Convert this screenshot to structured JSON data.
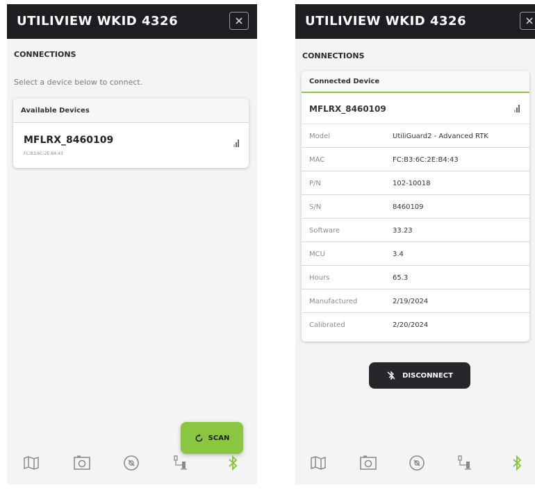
{
  "screens": [
    {
      "title": "UTILIVIEW WKID 4326",
      "section": "CONNECTIONS",
      "hint": "Select a device below to connect.",
      "card_title": "Available Devices",
      "device": {
        "name": "MFLRX_8460109",
        "mac": "FC:B3:6C:2E:B4:43"
      },
      "scan_label": "SCAN"
    },
    {
      "title": "UTILIVIEW WKID 4326",
      "section": "CONNECTIONS",
      "card_title": "Connected Device",
      "device_name": "MFLRX_8460109",
      "details": [
        {
          "label": "Model",
          "value": "UtiliGuard2 - Advanced RTK"
        },
        {
          "label": "MAC",
          "value": "FC:B3:6C:2E:B4:43"
        },
        {
          "label": "P/N",
          "value": "102-10018"
        },
        {
          "label": "S/N",
          "value": "8460109"
        },
        {
          "label": "Software",
          "value": "33.23"
        },
        {
          "label": "MCU",
          "value": "3.4"
        },
        {
          "label": "Hours",
          "value": "65.3"
        },
        {
          "label": "Manufactured",
          "value": "2/19/2024"
        },
        {
          "label": "Calibrated",
          "value": "2/20/2024"
        }
      ],
      "disconnect_label": "DISCONNECT"
    }
  ],
  "colors": {
    "header": "#1d1e22",
    "accent": "#8bc640",
    "background": "#f4f4f4"
  },
  "nav_icons": [
    "map-icon",
    "camera-icon",
    "compass-icon",
    "gps-receiver-icon",
    "bluetooth-icon"
  ],
  "active_nav": "bluetooth-icon"
}
